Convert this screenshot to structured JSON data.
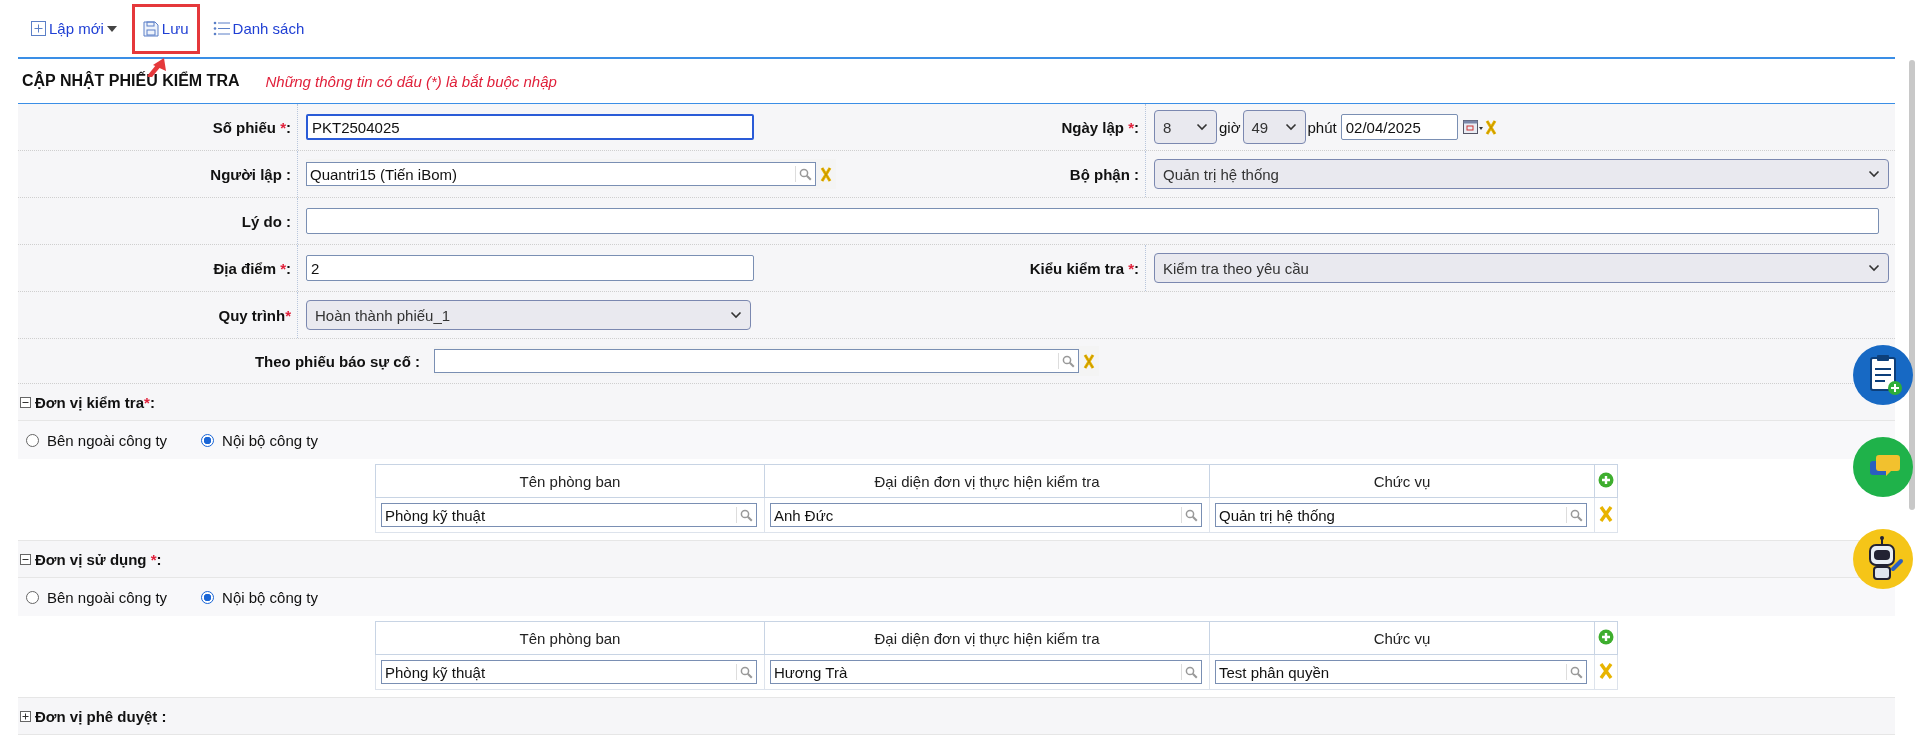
{
  "toolbar": {
    "items": [
      {
        "kind": "add",
        "label": "Lập mới",
        "has_menu": true,
        "highlighted": false
      },
      {
        "kind": "save",
        "label": "Lưu",
        "has_menu": false,
        "highlighted": true
      },
      {
        "kind": "list",
        "label": "Danh sách",
        "has_menu": false,
        "highlighted": false
      }
    ]
  },
  "form": {
    "title": "CẬP NHẬT PHIẾU KIỂM TRA",
    "note": "Những thông tin có dấu (*) là bắt buộc nhập",
    "rows": [
      {
        "kind": "pair",
        "fields": [
          {
            "kind": "text",
            "label": "Số phiếu ",
            "asterisk": "*",
            "after": ":",
            "value": "PKT2504025",
            "focused": true
          },
          {
            "kind": "datetime",
            "label": "Ngày lập ",
            "asterisk": "*",
            "after": ":",
            "hour": "8",
            "hour_unit": "giờ",
            "minute": "49",
            "minute_unit": "phút",
            "date": "02/04/2025"
          }
        ]
      },
      {
        "kind": "pair",
        "fields": [
          {
            "kind": "lookup",
            "label": "Người lập :",
            "value": "Quantri15 (Tiến iBom)"
          },
          {
            "kind": "select",
            "label": "Bộ phận :",
            "value": "Quản trị hệ thống"
          }
        ]
      },
      {
        "kind": "full",
        "fields": [
          {
            "kind": "text",
            "label": "Lý do :",
            "focused": false
          }
        ]
      },
      {
        "kind": "pair",
        "fields": [
          {
            "kind": "text",
            "label": "Địa điểm ",
            "asterisk": "*",
            "after": ":",
            "value": "2",
            "focused": false
          },
          {
            "kind": "select",
            "label": "Kiểu kiểm tra ",
            "asterisk": "*",
            "after": ":",
            "value": "Kiểm tra theo yêu cầu"
          }
        ]
      },
      {
        "kind": "pair",
        "fields": [
          {
            "kind": "select",
            "label": "Quy trình",
            "asterisk": "*",
            "value": "Hoàn thành phiếu_1"
          }
        ]
      },
      {
        "kind": "offset",
        "fields": [
          {
            "kind": "lookup",
            "label": "Theo phiếu báo sự cố :"
          }
        ]
      }
    ]
  },
  "sections": [
    {
      "title": "Đơn vị kiểm tra",
      "asterisk": "*",
      "after": ":",
      "expanded": true,
      "options": [
        {
          "label": "Bên ngoài công ty",
          "selected": false
        },
        {
          "label": "Nội bộ công ty",
          "selected": true
        }
      ],
      "columns": [
        "Tên phòng ban",
        "Đại diện đơn vị thực hiện kiểm tra",
        "Chức vụ"
      ],
      "rows": [
        {
          "cells": [
            "Phòng kỹ thuật",
            "Anh Đức",
            "Quản trị hệ thống"
          ]
        }
      ]
    },
    {
      "title": "Đơn vị sử dụng ",
      "asterisk": "*",
      "after": ":",
      "expanded": true,
      "options": [
        {
          "label": "Bên ngoài công ty",
          "selected": false
        },
        {
          "label": "Nội bộ công ty",
          "selected": true
        }
      ],
      "columns": [
        "Tên phòng ban",
        "Đại diện đơn vị thực hiện kiểm tra",
        "Chức vụ"
      ],
      "rows": [
        {
          "cells": [
            "Phòng kỹ thuật",
            "Hương Trà",
            "Test phân quyền"
          ]
        }
      ]
    },
    {
      "title": "Đơn vị phê duyệt :",
      "expanded": false
    }
  ],
  "floating_buttons": [
    {
      "kind": "clipboard"
    },
    {
      "kind": "chat"
    },
    {
      "kind": "robot"
    }
  ]
}
